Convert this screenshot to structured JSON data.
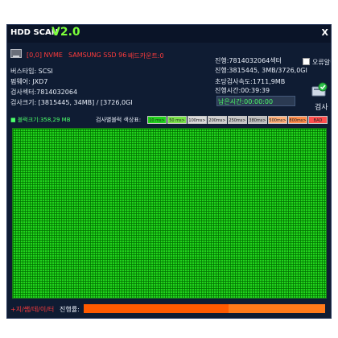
{
  "app": {
    "title": "HDD SCAN",
    "version": "V2.0",
    "close": "X"
  },
  "device": {
    "port": "[0,0] NVME",
    "model": "SAMSUNG SSD 96",
    "bad_count": "배드카운트:0",
    "interface": "버스타입: SCSI",
    "firmware": "펌웨어: JXD7",
    "sectors": "검사섹터:7814032064",
    "size": "검사크기: [3815445, 34MB] / [3726,0GI"
  },
  "status": {
    "progress_sectors": "진행:7814032064섹터",
    "progress_size": "진행:3815445, 3MB/3726,0GI",
    "speed": "초당검사속도:1711,9MB",
    "elapsed": "진행시간:00:39:39",
    "remaining": "남은시간:00:00:00"
  },
  "options": {
    "alarm_label": "오류알림",
    "scan_button": "검사"
  },
  "block": {
    "size_label": "블럭크기:358,29 MB",
    "legend_title": "검사별블럭 색상표:",
    "legend": [
      {
        "label": "10 ms>",
        "color": "#22d31d"
      },
      {
        "label": "50 ms>",
        "color": "#7be34a"
      },
      {
        "label": "100ms>",
        "color": "#d9d9d9"
      },
      {
        "label": "200ms>",
        "color": "#cfcfcf"
      },
      {
        "label": "250ms>",
        "color": "#c6c6c6"
      },
      {
        "label": "380ms>",
        "color": "#bdbdbd"
      },
      {
        "label": "500ms>",
        "color": "#ffb07a"
      },
      {
        "label": "800ms>",
        "color": "#ff8c4a"
      },
      {
        "label": "BAD",
        "color": "#ff4d4d"
      }
    ]
  },
  "footer": {
    "repair_label": "+지/쌤/데/이/터",
    "progress_label": "진행률:",
    "progress": 0.6
  },
  "colors": {
    "accent_green": "#22d31d",
    "progress_orange": "#ff7a1a"
  }
}
